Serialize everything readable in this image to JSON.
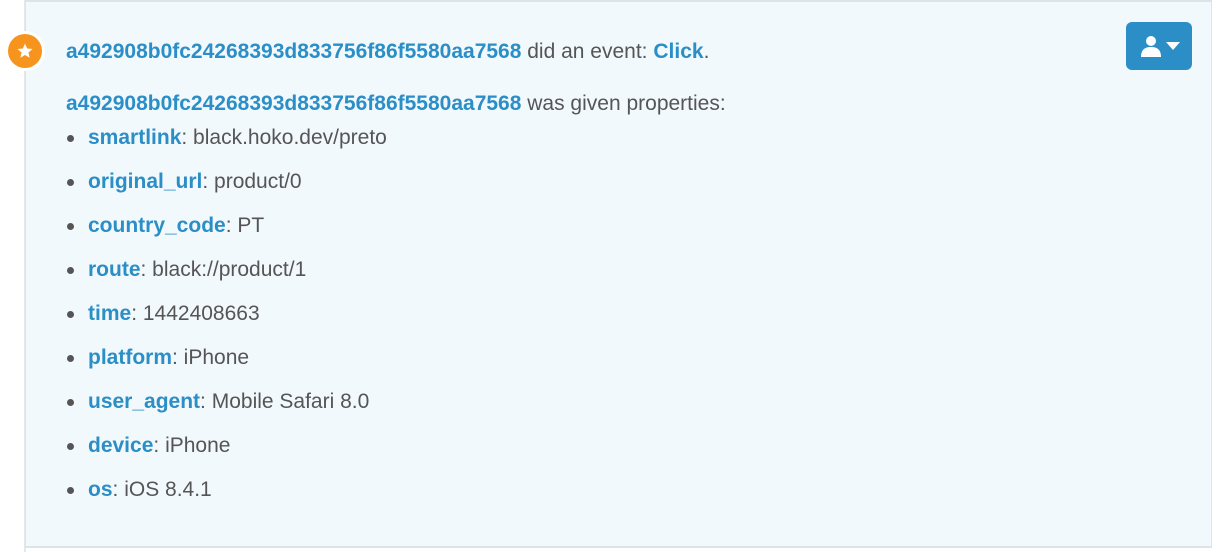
{
  "event": {
    "user_id": "a492908b0fc24268393d833756f86f5580aa7568",
    "did_event_text": " did an event: ",
    "event_name": "Click",
    "event_suffix": ".",
    "given_properties_text": " was given properties:",
    "properties": [
      {
        "key": "smartlink",
        "value": "black.hoko.dev/preto"
      },
      {
        "key": "original_url",
        "value": "product/0"
      },
      {
        "key": "country_code",
        "value": "PT"
      },
      {
        "key": "route",
        "value": "black://product/1"
      },
      {
        "key": "time",
        "value": "1442408663"
      },
      {
        "key": "platform",
        "value": "iPhone"
      },
      {
        "key": "user_agent",
        "value": "Mobile Safari 8.0"
      },
      {
        "key": "device",
        "value": "iPhone"
      },
      {
        "key": "os",
        "value": "iOS 8.4.1"
      }
    ],
    "separator": ": "
  },
  "icons": {
    "badge": "star-icon",
    "menu_button": "user-icon",
    "menu_caret": "caret-down-icon"
  },
  "colors": {
    "link": "#2b8ec6",
    "badge": "#f7941d",
    "card_background": "#f2f9fd",
    "button": "#2b8ec6"
  }
}
